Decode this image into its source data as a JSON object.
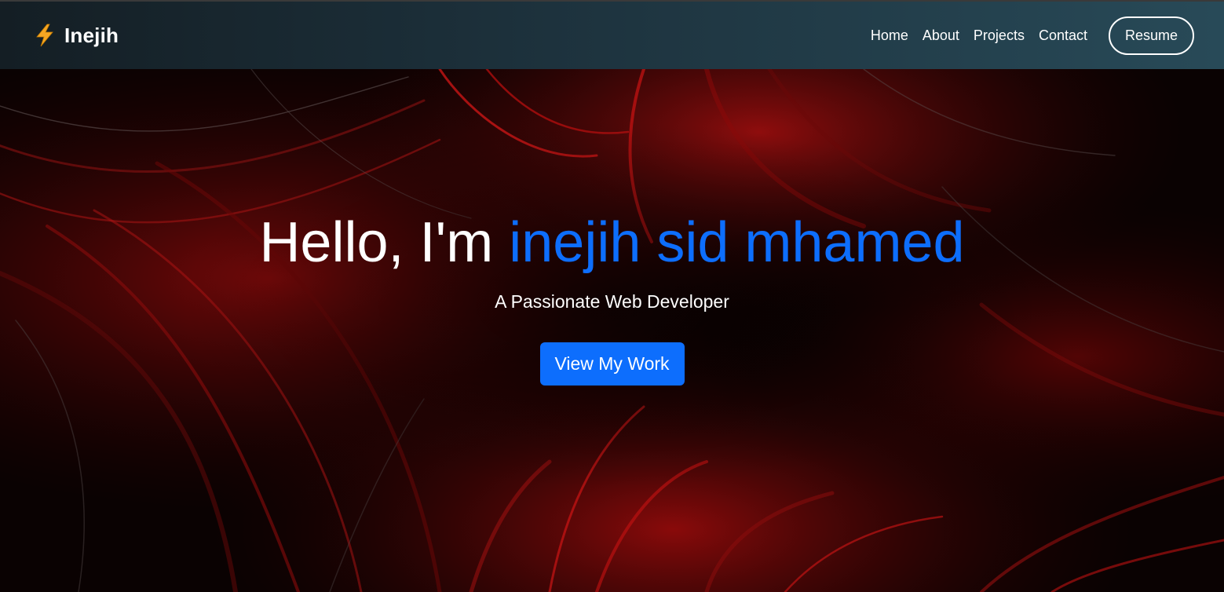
{
  "colors": {
    "accent": "#0d6efd",
    "navbar_start": "#141e24",
    "navbar_end": "#284a58",
    "hero_red": "#d41010",
    "text": "#ffffff"
  },
  "navbar": {
    "brand_icon": "lightning-bolt-icon",
    "brand_name": "Inejih",
    "links": [
      {
        "label": "Home"
      },
      {
        "label": "About"
      },
      {
        "label": "Projects"
      },
      {
        "label": "Contact"
      }
    ],
    "resume_label": "Resume"
  },
  "hero": {
    "greeting": "Hello, I'm ",
    "name": "inejih sid mhamed",
    "subtitle": "A Passionate Web Developer",
    "cta_label": "View My Work",
    "background": "red-black-fractal-swirl"
  }
}
